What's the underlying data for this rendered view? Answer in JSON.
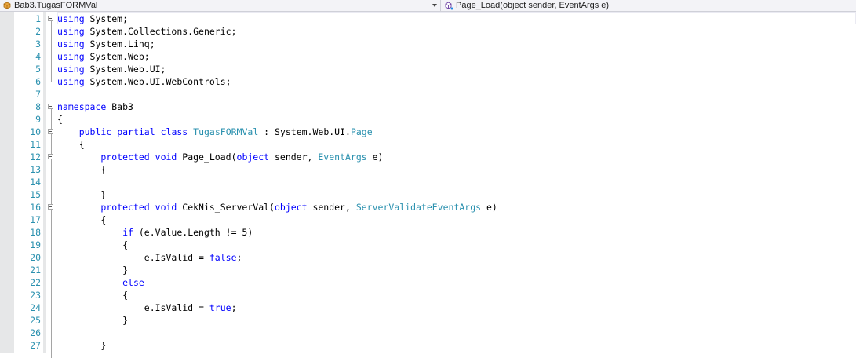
{
  "navigation": {
    "type_dropdown": {
      "value": "Bab3.TugasFORMVal",
      "icon": "class-icon"
    },
    "member_dropdown": {
      "value": "Page_Load(object sender, EventArgs e)",
      "icon": "method-icon"
    }
  },
  "colors": {
    "keyword": "#0000ff",
    "type": "#2b91af",
    "line_number": "#2b91af",
    "text": "#000000"
  },
  "editor": {
    "lines": [
      {
        "n": "1",
        "tokens": [
          {
            "t": "using",
            "c": "kw"
          },
          {
            "t": " System;"
          }
        ]
      },
      {
        "n": "2",
        "tokens": [
          {
            "t": "using",
            "c": "kw"
          },
          {
            "t": " System.Collections.Generic;"
          }
        ]
      },
      {
        "n": "3",
        "tokens": [
          {
            "t": "using",
            "c": "kw"
          },
          {
            "t": " System.Linq;"
          }
        ]
      },
      {
        "n": "4",
        "tokens": [
          {
            "t": "using",
            "c": "kw"
          },
          {
            "t": " System.Web;"
          }
        ]
      },
      {
        "n": "5",
        "tokens": [
          {
            "t": "using",
            "c": "kw"
          },
          {
            "t": " System.Web.UI;"
          }
        ]
      },
      {
        "n": "6",
        "tokens": [
          {
            "t": "using",
            "c": "kw"
          },
          {
            "t": " System.Web.UI.WebControls;"
          }
        ]
      },
      {
        "n": "7",
        "tokens": []
      },
      {
        "n": "8",
        "tokens": [
          {
            "t": "namespace",
            "c": "kw"
          },
          {
            "t": " Bab3"
          }
        ]
      },
      {
        "n": "9",
        "tokens": [
          {
            "t": "{"
          }
        ]
      },
      {
        "n": "10",
        "tokens": [
          {
            "t": "    "
          },
          {
            "t": "public",
            "c": "kw"
          },
          {
            "t": " "
          },
          {
            "t": "partial",
            "c": "kw"
          },
          {
            "t": " "
          },
          {
            "t": "class",
            "c": "kw"
          },
          {
            "t": " "
          },
          {
            "t": "TugasFORMVal",
            "c": "ty"
          },
          {
            "t": " : System.Web.UI."
          },
          {
            "t": "Page",
            "c": "ty"
          }
        ]
      },
      {
        "n": "11",
        "tokens": [
          {
            "t": "    {"
          }
        ]
      },
      {
        "n": "12",
        "tokens": [
          {
            "t": "        "
          },
          {
            "t": "protected",
            "c": "kw"
          },
          {
            "t": " "
          },
          {
            "t": "void",
            "c": "kw"
          },
          {
            "t": " Page_Load("
          },
          {
            "t": "object",
            "c": "kw"
          },
          {
            "t": " sender, "
          },
          {
            "t": "EventArgs",
            "c": "ty"
          },
          {
            "t": " e)"
          }
        ]
      },
      {
        "n": "13",
        "tokens": [
          {
            "t": "        {"
          }
        ]
      },
      {
        "n": "14",
        "tokens": []
      },
      {
        "n": "15",
        "tokens": [
          {
            "t": "        }"
          }
        ]
      },
      {
        "n": "16",
        "tokens": [
          {
            "t": "        "
          },
          {
            "t": "protected",
            "c": "kw"
          },
          {
            "t": " "
          },
          {
            "t": "void",
            "c": "kw"
          },
          {
            "t": " CekNis_ServerVal("
          },
          {
            "t": "object",
            "c": "kw"
          },
          {
            "t": " sender, "
          },
          {
            "t": "ServerValidateEventArgs",
            "c": "ty"
          },
          {
            "t": " e)"
          }
        ]
      },
      {
        "n": "17",
        "tokens": [
          {
            "t": "        {"
          }
        ]
      },
      {
        "n": "18",
        "tokens": [
          {
            "t": "            "
          },
          {
            "t": "if",
            "c": "kw"
          },
          {
            "t": " (e.Value.Length != 5)"
          }
        ]
      },
      {
        "n": "19",
        "tokens": [
          {
            "t": "            {"
          }
        ]
      },
      {
        "n": "20",
        "tokens": [
          {
            "t": "                e.IsValid = "
          },
          {
            "t": "false",
            "c": "kw"
          },
          {
            "t": ";"
          }
        ]
      },
      {
        "n": "21",
        "tokens": [
          {
            "t": "            }"
          }
        ]
      },
      {
        "n": "22",
        "tokens": [
          {
            "t": "            "
          },
          {
            "t": "else",
            "c": "kw"
          }
        ]
      },
      {
        "n": "23",
        "tokens": [
          {
            "t": "            {"
          }
        ]
      },
      {
        "n": "24",
        "tokens": [
          {
            "t": "                e.IsValid = "
          },
          {
            "t": "true",
            "c": "kw"
          },
          {
            "t": ";"
          }
        ]
      },
      {
        "n": "25",
        "tokens": [
          {
            "t": "            }"
          }
        ]
      },
      {
        "n": "26",
        "tokens": []
      },
      {
        "n": "27",
        "tokens": [
          {
            "t": "        }"
          }
        ]
      }
    ]
  }
}
